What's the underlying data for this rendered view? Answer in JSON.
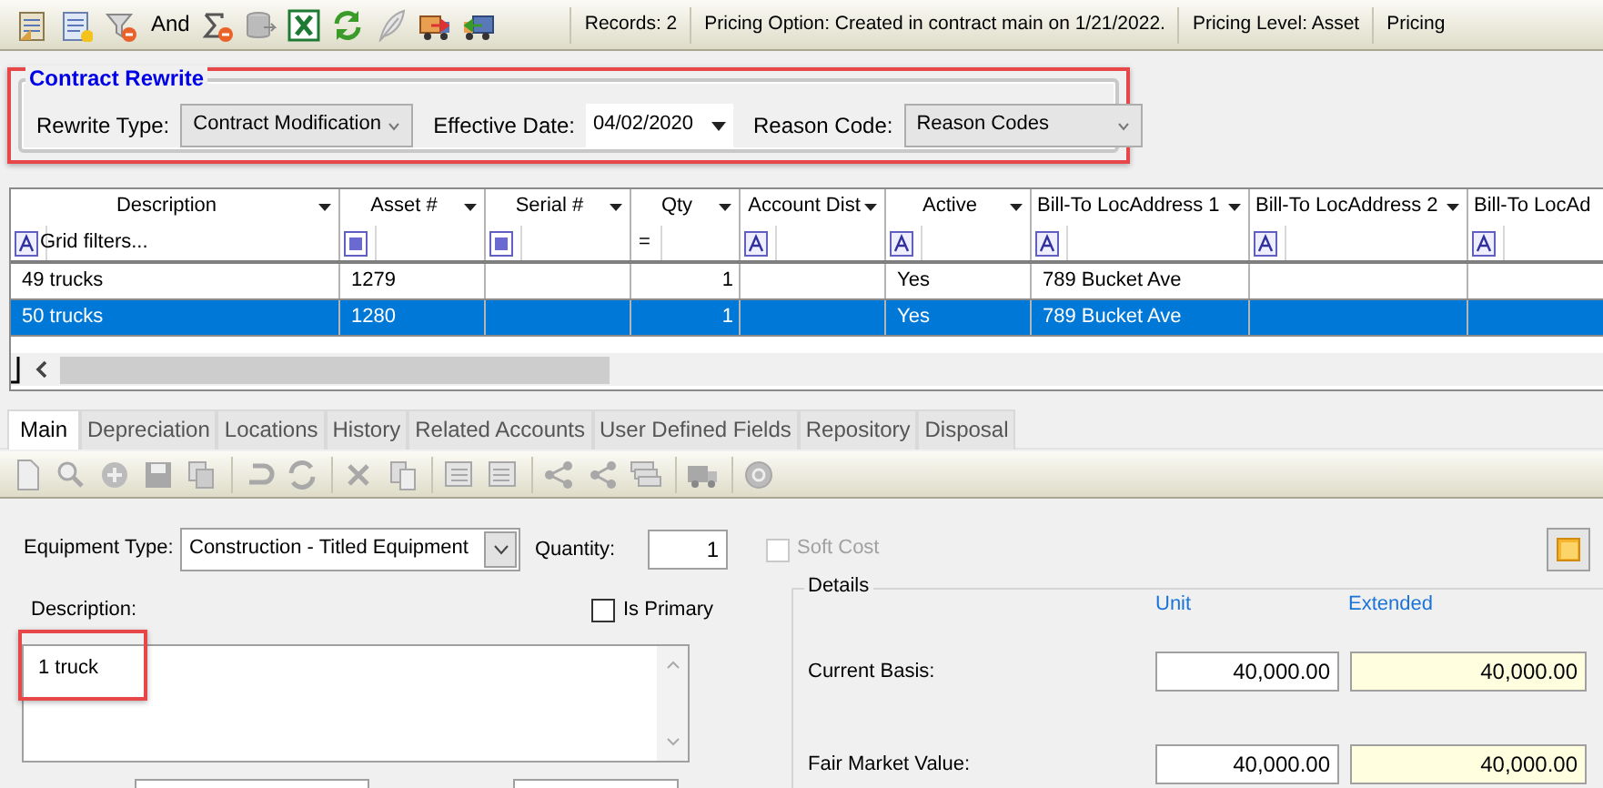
{
  "toolbar": {
    "and_label": "And",
    "status": [
      "Records: 2",
      "Pricing Option: Created in contract main on 1/21/2022.",
      "Pricing Level: Asset",
      "Pricing"
    ]
  },
  "rewrite": {
    "title": "Contract Rewrite",
    "highlighted": true,
    "fields": [
      {
        "label": "Rewrite Type:",
        "kind": "dropdown",
        "value": "Contract Modification"
      },
      {
        "label": "Effective Date:",
        "kind": "date",
        "value": "04/02/2020"
      },
      {
        "label": "Reason Code:",
        "kind": "dropdown",
        "value": "Reason Codes"
      }
    ]
  },
  "grid": {
    "columns": [
      {
        "title": "Description",
        "filter": {
          "kind": "text",
          "hint": "Grid filters..."
        }
      },
      {
        "title": "Asset #",
        "filter": {
          "kind": "list"
        }
      },
      {
        "title": "Serial #",
        "filter": {
          "kind": "list"
        }
      },
      {
        "title": "Qty",
        "filter": {
          "kind": "operator",
          "operator": "="
        }
      },
      {
        "title": "Account Dist",
        "filter": {
          "kind": "text"
        }
      },
      {
        "title": "Active",
        "filter": {
          "kind": "text"
        }
      },
      {
        "title": "Bill-To LocAddress 1",
        "filter": {
          "kind": "text"
        }
      },
      {
        "title": "Bill-To LocAddress 2",
        "filter": {
          "kind": "text"
        }
      },
      {
        "title": "Bill-To LocAd",
        "filter": {
          "kind": "text"
        }
      }
    ],
    "rows": [
      {
        "selected": false,
        "cells": [
          "49 trucks",
          "1279",
          "",
          "1",
          "",
          "Yes",
          "789 Bucket Ave",
          "",
          ""
        ]
      },
      {
        "selected": true,
        "cells": [
          "50 trucks",
          "1280",
          "",
          "1",
          "",
          "Yes",
          "789 Bucket Ave",
          "",
          ""
        ]
      }
    ]
  },
  "tabs": [
    {
      "label": "Main",
      "selected": true
    },
    {
      "label": "Depreciation",
      "selected": false
    },
    {
      "label": "Locations",
      "selected": false
    },
    {
      "label": "History",
      "selected": false
    },
    {
      "label": "Related Accounts",
      "selected": false
    },
    {
      "label": "User Defined Fields",
      "selected": false
    },
    {
      "label": "Repository",
      "selected": false
    },
    {
      "label": "Disposal",
      "selected": false
    }
  ],
  "form": {
    "equipment_type": {
      "label": "Equipment Type:",
      "value": "Construction - Titled Equipment"
    },
    "quantity": {
      "label": "Quantity:",
      "value": "1"
    },
    "soft_cost": {
      "label": "Soft Cost",
      "checked": false,
      "disabled": true
    },
    "description": {
      "label": "Description:",
      "value": "1 truck",
      "highlighted": true
    },
    "is_primary": {
      "label": "Is Primary",
      "checked": false
    },
    "details": {
      "title": "Details",
      "unit_label": "Unit",
      "extended_label": "Extended",
      "rows": [
        {
          "label": "Current Basis:",
          "unit": "40,000.00",
          "extended": "40,000.00"
        },
        {
          "label": "Fair Market Value:",
          "unit": "40,000.00",
          "extended": "40,000.00"
        }
      ]
    }
  }
}
